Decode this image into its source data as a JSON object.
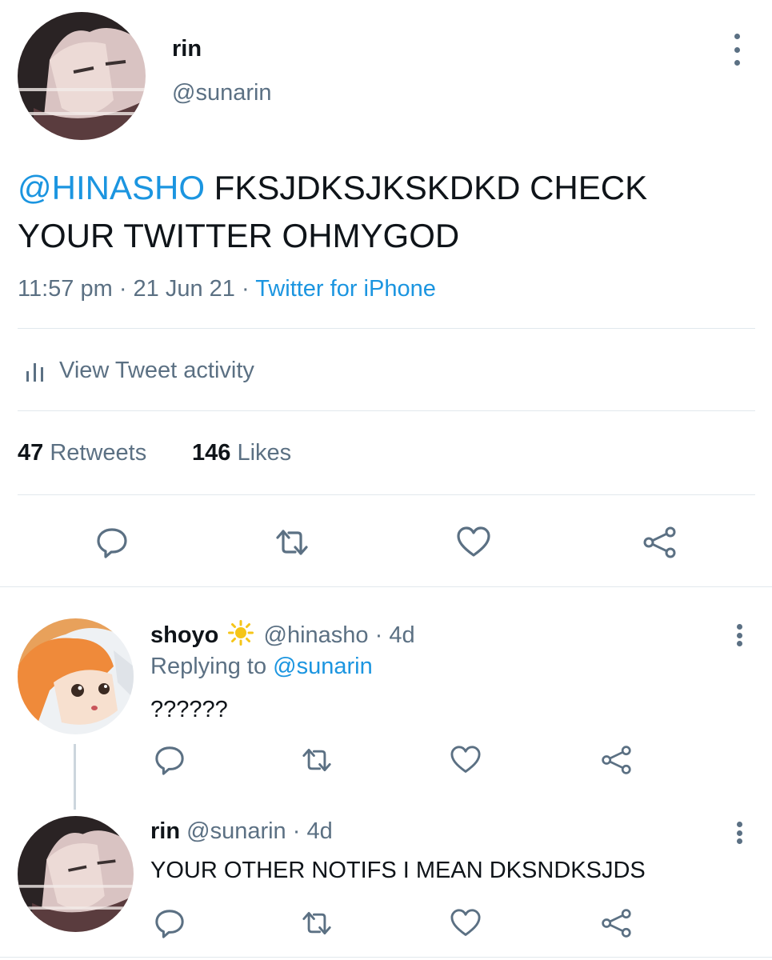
{
  "main_tweet": {
    "display_name": "rin",
    "handle": "@sunarin",
    "mention": "@HINASHO",
    "text_line1": " FKSJDKSJKSKDKD CHECK",
    "text_line2": "YOUR TWITTER OHMYGOD",
    "time": "11:57 pm",
    "dot1": " · ",
    "date": "21 Jun 21",
    "dot2": " · ",
    "source": "Twitter for iPhone",
    "activity_label": "View Tweet activity",
    "retweets_count": "47",
    "retweets_label": " Retweets",
    "likes_count": "146",
    "likes_label": " Likes"
  },
  "reply1": {
    "display_name": "shoyo",
    "emoji": "🔆",
    "handle_time": "@hinasho · 4d",
    "replying_prefix": "Replying to ",
    "replying_to": "@sunarin",
    "text": "??????"
  },
  "reply2": {
    "display_name": "rin",
    "handle_time": "@sunarin · 4d",
    "text": "YOUR OTHER NOTIFS I MEAN DKSNDKSJDS"
  },
  "colors": {
    "link": "#1b95e0",
    "grey": "#5b7083",
    "divider": "#e1e8ed",
    "text": "#0f1419"
  }
}
